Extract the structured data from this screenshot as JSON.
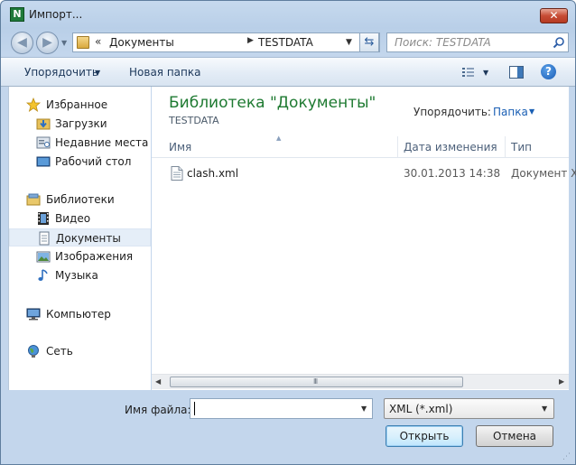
{
  "window": {
    "title": "Импорт...",
    "app_icon_letter": "N",
    "close_symbol": "✕"
  },
  "nav": {
    "breadcrumb_prefix": "«",
    "breadcrumbs": [
      "Документы",
      "TESTDATA"
    ],
    "separator": "▶",
    "search_placeholder": "Поиск: TESTDATA"
  },
  "toolbar": {
    "organize_label": "Упорядочить",
    "new_folder_label": "Новая папка"
  },
  "sidebar": {
    "favorites": {
      "label": "Избранное",
      "items": [
        "Загрузки",
        "Недавние места",
        "Рабочий стол"
      ]
    },
    "libraries": {
      "label": "Библиотеки",
      "items": [
        "Видео",
        "Документы",
        "Изображения",
        "Музыка"
      ],
      "selected": "Документы"
    },
    "computer": "Компьютер",
    "network": "Сеть"
  },
  "main": {
    "library_title": "Библиотека \"Документы\"",
    "library_subtitle": "TESTDATA",
    "arrange_label": "Упорядочить:",
    "arrange_value": "Папка",
    "columns": [
      "Имя",
      "Дата изменения",
      "Тип"
    ],
    "files": [
      {
        "name": "clash.xml",
        "date": "30.01.2013 14:38",
        "type": "Документ X"
      }
    ],
    "scroll_grip": "III"
  },
  "bottom": {
    "filename_label": "Имя файла:",
    "filename_value": "",
    "filter_value": "XML (*.xml)",
    "open_button": "Открыть",
    "cancel_button": "Отмена"
  },
  "colors": {
    "library_title": "#1e7a31",
    "link": "#1a5fb4",
    "window_frame": "#b9cfe8"
  }
}
